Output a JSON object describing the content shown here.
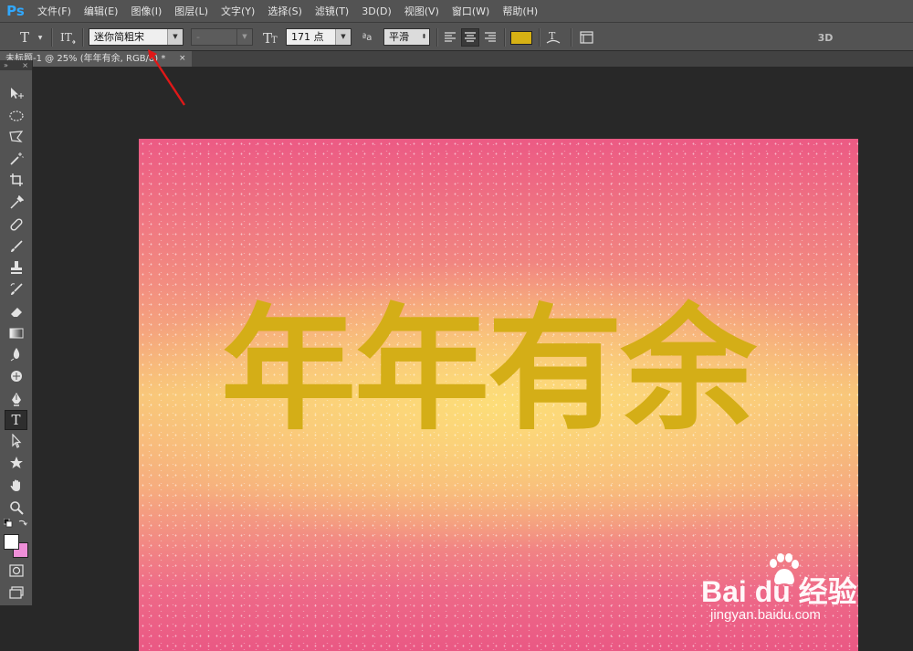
{
  "app": {
    "logo": "Ps"
  },
  "menu": [
    "文件(F)",
    "编辑(E)",
    "图像(I)",
    "图层(L)",
    "文字(Y)",
    "选择(S)",
    "滤镜(T)",
    "3D(D)",
    "视图(V)",
    "窗口(W)",
    "帮助(H)"
  ],
  "options": {
    "tool_icon": "T",
    "font_family": "迷你简粗宋",
    "font_style": "-",
    "font_size": "171 点",
    "aa_label": "ªa",
    "antialias": "平滑",
    "text_color": "#d6b114",
    "three_d": "3D"
  },
  "document": {
    "tab_title": "未标题-1 @ 25% (年年有余, RGB/8) *",
    "close": "×"
  },
  "tools_panel": {
    "collapse": "»",
    "close": "×"
  },
  "canvas": {
    "text": "年年有余"
  },
  "watermark": {
    "main": "Bai du 经验",
    "sub": "jingyan.baidu.com"
  },
  "colors": {
    "foreground": "#ffffff",
    "background": "#ee8fd8",
    "accent": "#31a8ff"
  }
}
